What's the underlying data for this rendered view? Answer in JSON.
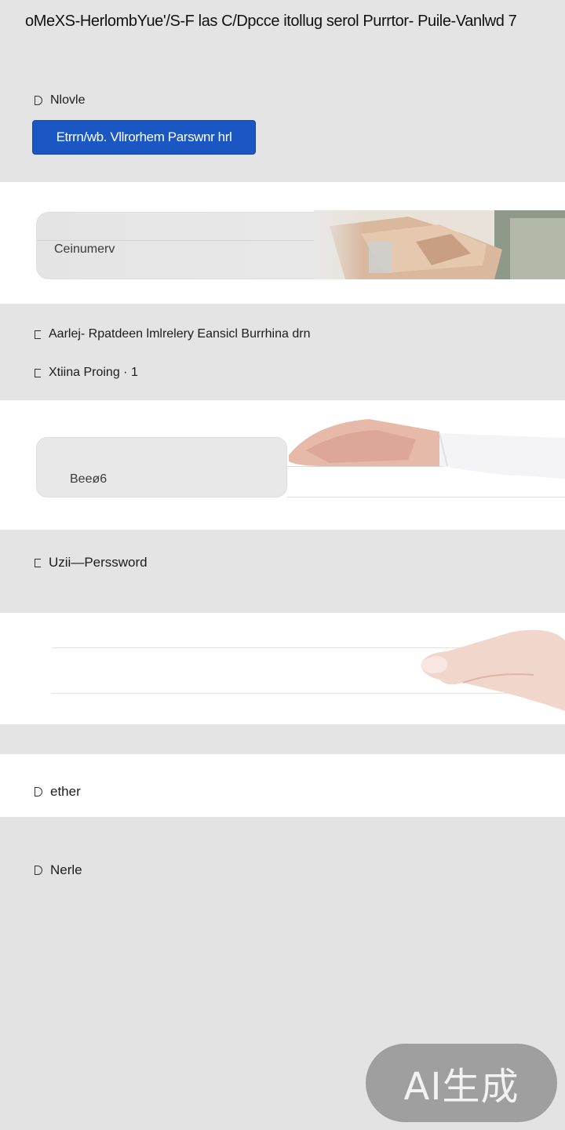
{
  "header": {
    "title": "oMeXS-HerlombYue'/S-F las C/Dpcce itollug serol Purrtor- Puile-Vanlwd 7"
  },
  "section1": {
    "item_label": "Nlovle",
    "primary_button": "Etrrn/wb. Vllrorhem Parswnr hrl"
  },
  "card1": {
    "label": "Ceinumerv"
  },
  "section2": {
    "item1_label": "Aarlej- Rpatdeen lmlrelery  Eansicl Burrhina drn",
    "item2_label": "Xtiina Proing · 1"
  },
  "card2": {
    "label": "Beeø6"
  },
  "section3": {
    "item_label": "Uzii—Perssword"
  },
  "section4": {
    "item_label": "ether"
  },
  "section5": {
    "item_label": "Nerle"
  },
  "watermark": {
    "text": "AI生成"
  },
  "colors": {
    "primary": "#1a57c4",
    "gray_band": "#e4e4e4",
    "white_band": "#ffffff"
  }
}
